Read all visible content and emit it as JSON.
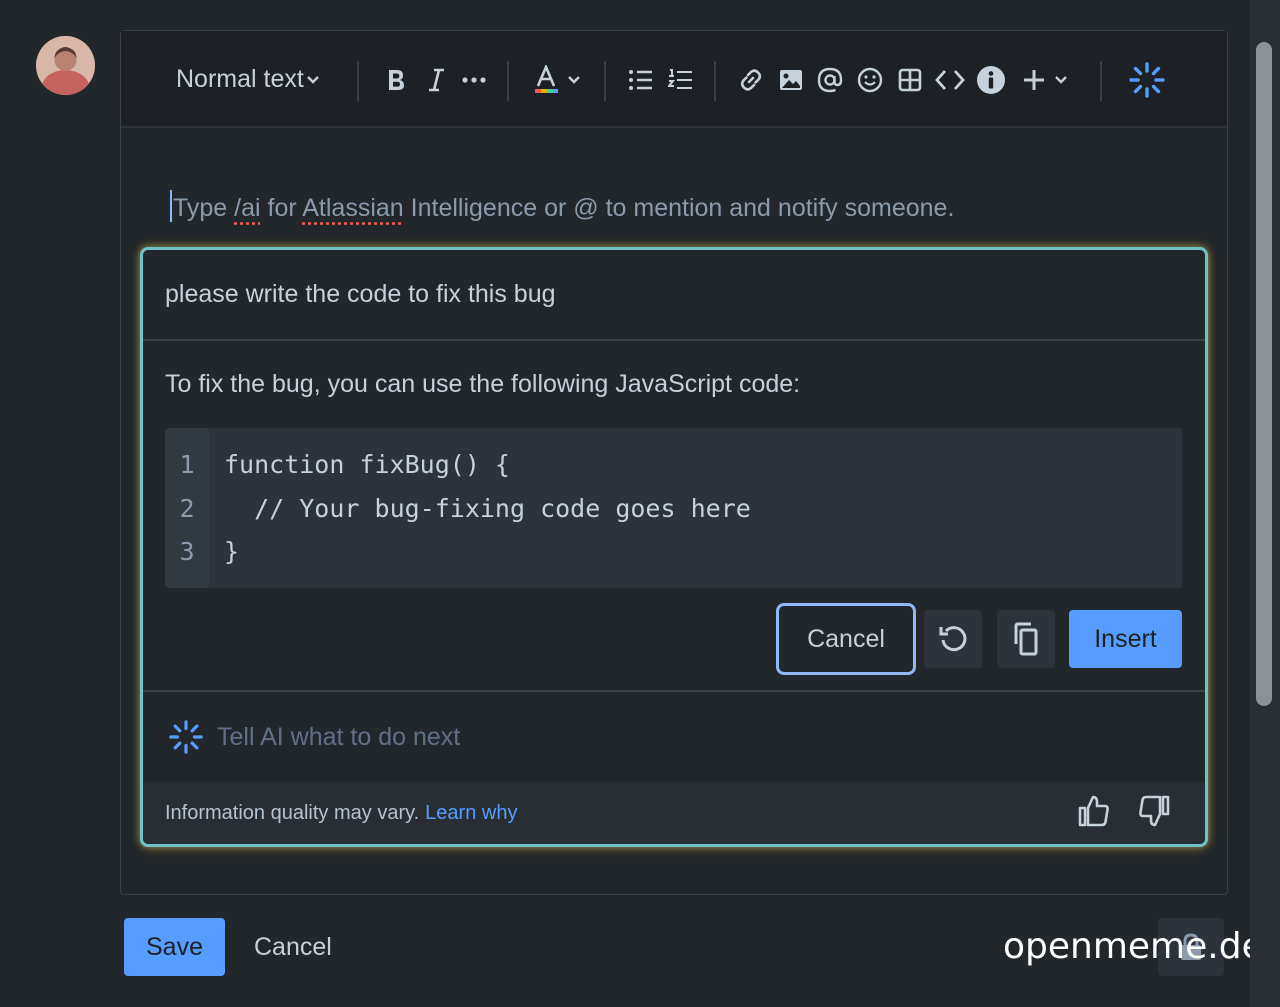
{
  "toolbar": {
    "text_style": "Normal text",
    "icons": [
      "bold-icon",
      "italic-icon",
      "more-formatting-icon",
      "text-color-icon",
      "chevron-down-icon",
      "bullet-list-icon",
      "numbered-list-icon",
      "link-icon",
      "image-icon",
      "mention-icon",
      "emoji-icon",
      "table-icon",
      "code-icon",
      "info-icon",
      "plus-icon",
      "chevron-down-icon",
      "atlassian-intelligence-icon"
    ]
  },
  "editor": {
    "placeholder_parts": [
      "Type ",
      "/ai",
      " for ",
      "Atlassian",
      " Intelligence or @ to mention and notify someone."
    ]
  },
  "ai": {
    "prompt": "please write the code to fix this bug",
    "answer": "To fix the bug, you can use the following JavaScript code:",
    "code_lines": [
      {
        "n": "1",
        "text": "function fixBug() {"
      },
      {
        "n": "2",
        "text": "  // Your bug-fixing code goes here"
      },
      {
        "n": "3",
        "text": "}"
      }
    ],
    "cancel_label": "Cancel",
    "insert_label": "Insert",
    "next_placeholder": "Tell AI what to do next",
    "disclaimer": "Information quality may vary.",
    "learn_link": "Learn why"
  },
  "actions": {
    "save_label": "Save",
    "cancel_label": "Cancel"
  },
  "watermark": "openmeme.dev",
  "colors": {
    "background": "#22272b",
    "toolbar": "#1d2125",
    "accent_blue": "#579dff",
    "ai_border": "#6fc2c5",
    "ai_glow": "#e7aa32"
  }
}
